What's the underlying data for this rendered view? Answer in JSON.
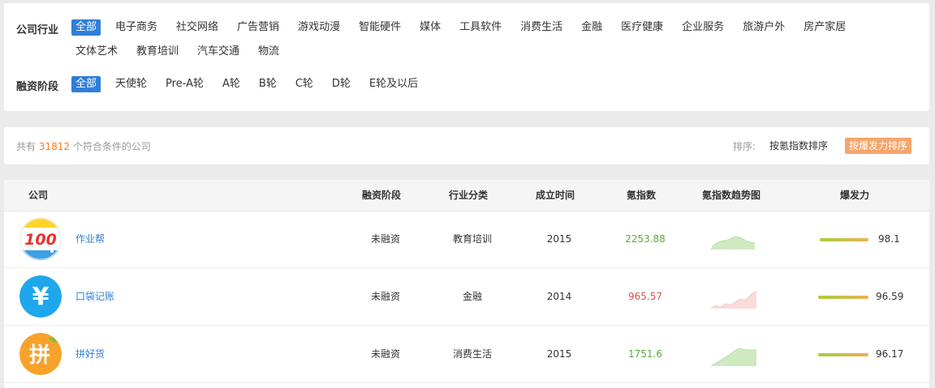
{
  "filters": {
    "industry": {
      "label": "公司行业",
      "options": [
        "全部",
        "电子商务",
        "社交网络",
        "广告营销",
        "游戏动漫",
        "智能硬件",
        "媒体",
        "工具软件",
        "消费生活",
        "金融",
        "医疗健康",
        "企业服务",
        "旅游户外",
        "房产家居",
        "文体艺术",
        "教育培训",
        "汽车交通",
        "物流"
      ],
      "selected": "全部"
    },
    "stage": {
      "label": "融资阶段",
      "options": [
        "全部",
        "天使轮",
        "Pre-A轮",
        "A轮",
        "B轮",
        "C轮",
        "D轮",
        "E轮及以后"
      ],
      "selected": "全部"
    }
  },
  "summary": {
    "prefix": "共有",
    "count": "31812",
    "suffix": "个符合条件的公司",
    "sort_label": "排序:",
    "sort_options": [
      "按氪指数排序",
      "按爆发力排序"
    ],
    "active_sort": "按爆发力排序"
  },
  "table": {
    "columns": [
      "公司",
      "融资阶段",
      "行业分类",
      "成立时间",
      "氪指数",
      "氪指数趋势图",
      "爆发力"
    ],
    "rows": [
      {
        "name": "作业帮",
        "stage": "未融资",
        "industry": "教育培训",
        "founded": "2015",
        "kr_index": "2253.88",
        "kr_color": "#5aaa3a",
        "trend": "up-flat",
        "trend_color": "green",
        "burst": "98.1",
        "burst_value": 98.1,
        "logo": "zuoyebang-logo"
      },
      {
        "name": "口袋记账",
        "stage": "未融资",
        "industry": "金融",
        "founded": "2014",
        "kr_index": "965.57",
        "kr_color": "#d9534f",
        "trend": "rising",
        "trend_color": "red",
        "burst": "96.59",
        "burst_value": 96.59,
        "logo": "yen-logo"
      },
      {
        "name": "拼好货",
        "stage": "未融资",
        "industry": "消费生活",
        "founded": "2015",
        "kr_index": "1751.6",
        "kr_color": "#5aaa3a",
        "trend": "up-flat",
        "trend_color": "green",
        "burst": "96.17",
        "burst_value": 96.17,
        "logo": "pin-logo"
      }
    ]
  },
  "logo_glyphs": {
    "zuoyebang": "100",
    "yen": "¥",
    "pin": "拼"
  }
}
